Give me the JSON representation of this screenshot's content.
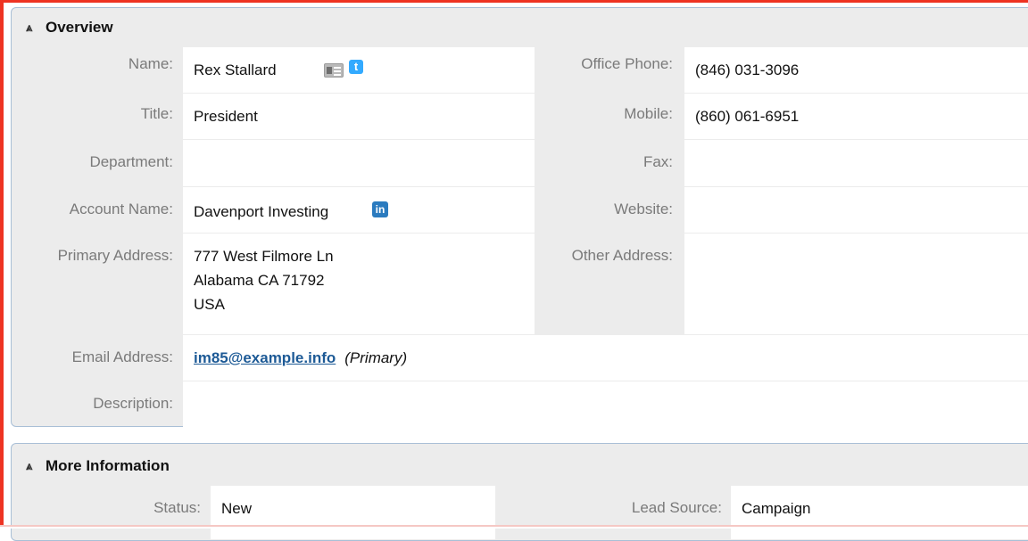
{
  "overview": {
    "title": "Overview",
    "fields": {
      "name": {
        "label": "Name:",
        "value": "Rex Stallard"
      },
      "office_phone": {
        "label": "Office Phone:",
        "value": "(846) 031-3096"
      },
      "title": {
        "label": "Title:",
        "value": "President"
      },
      "mobile": {
        "label": "Mobile:",
        "value": "(860) 061-6951"
      },
      "department": {
        "label": "Department:",
        "value": ""
      },
      "fax": {
        "label": "Fax:",
        "value": ""
      },
      "account_name": {
        "label": "Account Name:",
        "value": "Davenport Investing"
      },
      "website": {
        "label": "Website:",
        "value": ""
      },
      "primary_address": {
        "label": "Primary Address:",
        "lines": [
          "777 West Filmore Ln",
          "Alabama CA  71792",
          "USA"
        ]
      },
      "other_address": {
        "label": "Other Address:",
        "value": ""
      },
      "email_address": {
        "label": "Email Address:",
        "value": "im85@example.info",
        "tag": "(Primary)"
      },
      "description": {
        "label": "Description:",
        "value": ""
      }
    }
  },
  "more_information": {
    "title": "More Information",
    "fields": {
      "status": {
        "label": "Status:",
        "value": "New"
      },
      "lead_source": {
        "label": "Lead Source:",
        "value": "Campaign"
      }
    }
  },
  "icons": {
    "collapse": "chevron-double-up-icon",
    "vcard": "vcard-icon",
    "twitter": "twitter-icon",
    "linkedin": "linkedin-icon"
  },
  "colors": {
    "frame": "#ee3322",
    "panel_bg": "#ececec",
    "panel_border": "#a9bfd6",
    "link": "#1d5a96"
  }
}
